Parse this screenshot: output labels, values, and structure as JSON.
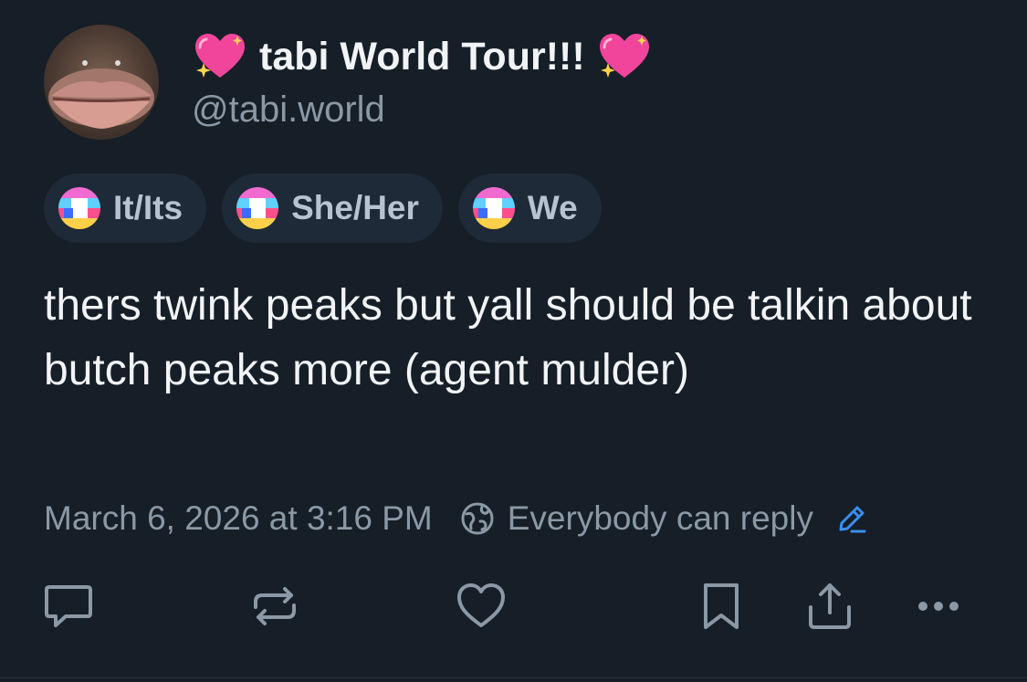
{
  "post": {
    "display_name": "tabi World Tour!!!",
    "name_prefix_emoji": "sparkling-heart",
    "name_suffix_emoji": "sparkling-heart",
    "handle": "@tabi.world",
    "text": "thers twink peaks but yall should be talkin about butch peaks more (agent mulder)",
    "timestamp": "March 6, 2026 at 3:16 PM",
    "reply_setting": "Everybody can reply"
  },
  "pronouns": [
    {
      "label": "It/Its",
      "icon": "pronoun-flag-icon"
    },
    {
      "label": "She/Her",
      "icon": "pronoun-flag-icon"
    },
    {
      "label": "We",
      "icon": "pronoun-flag-icon"
    }
  ],
  "actions": [
    {
      "name": "reply",
      "icon": "comment-icon"
    },
    {
      "name": "repost",
      "icon": "repost-icon"
    },
    {
      "name": "like",
      "icon": "heart-icon"
    },
    {
      "name": "bookmark",
      "icon": "bookmark-icon"
    },
    {
      "name": "share",
      "icon": "share-icon"
    },
    {
      "name": "more",
      "icon": "ellipsis-icon"
    }
  ],
  "colors": {
    "background": "#161e27",
    "text": "#f1f3f5",
    "muted": "#8b98a5",
    "pill_bg": "#1e2a37",
    "accent": "#3b8ef0"
  }
}
